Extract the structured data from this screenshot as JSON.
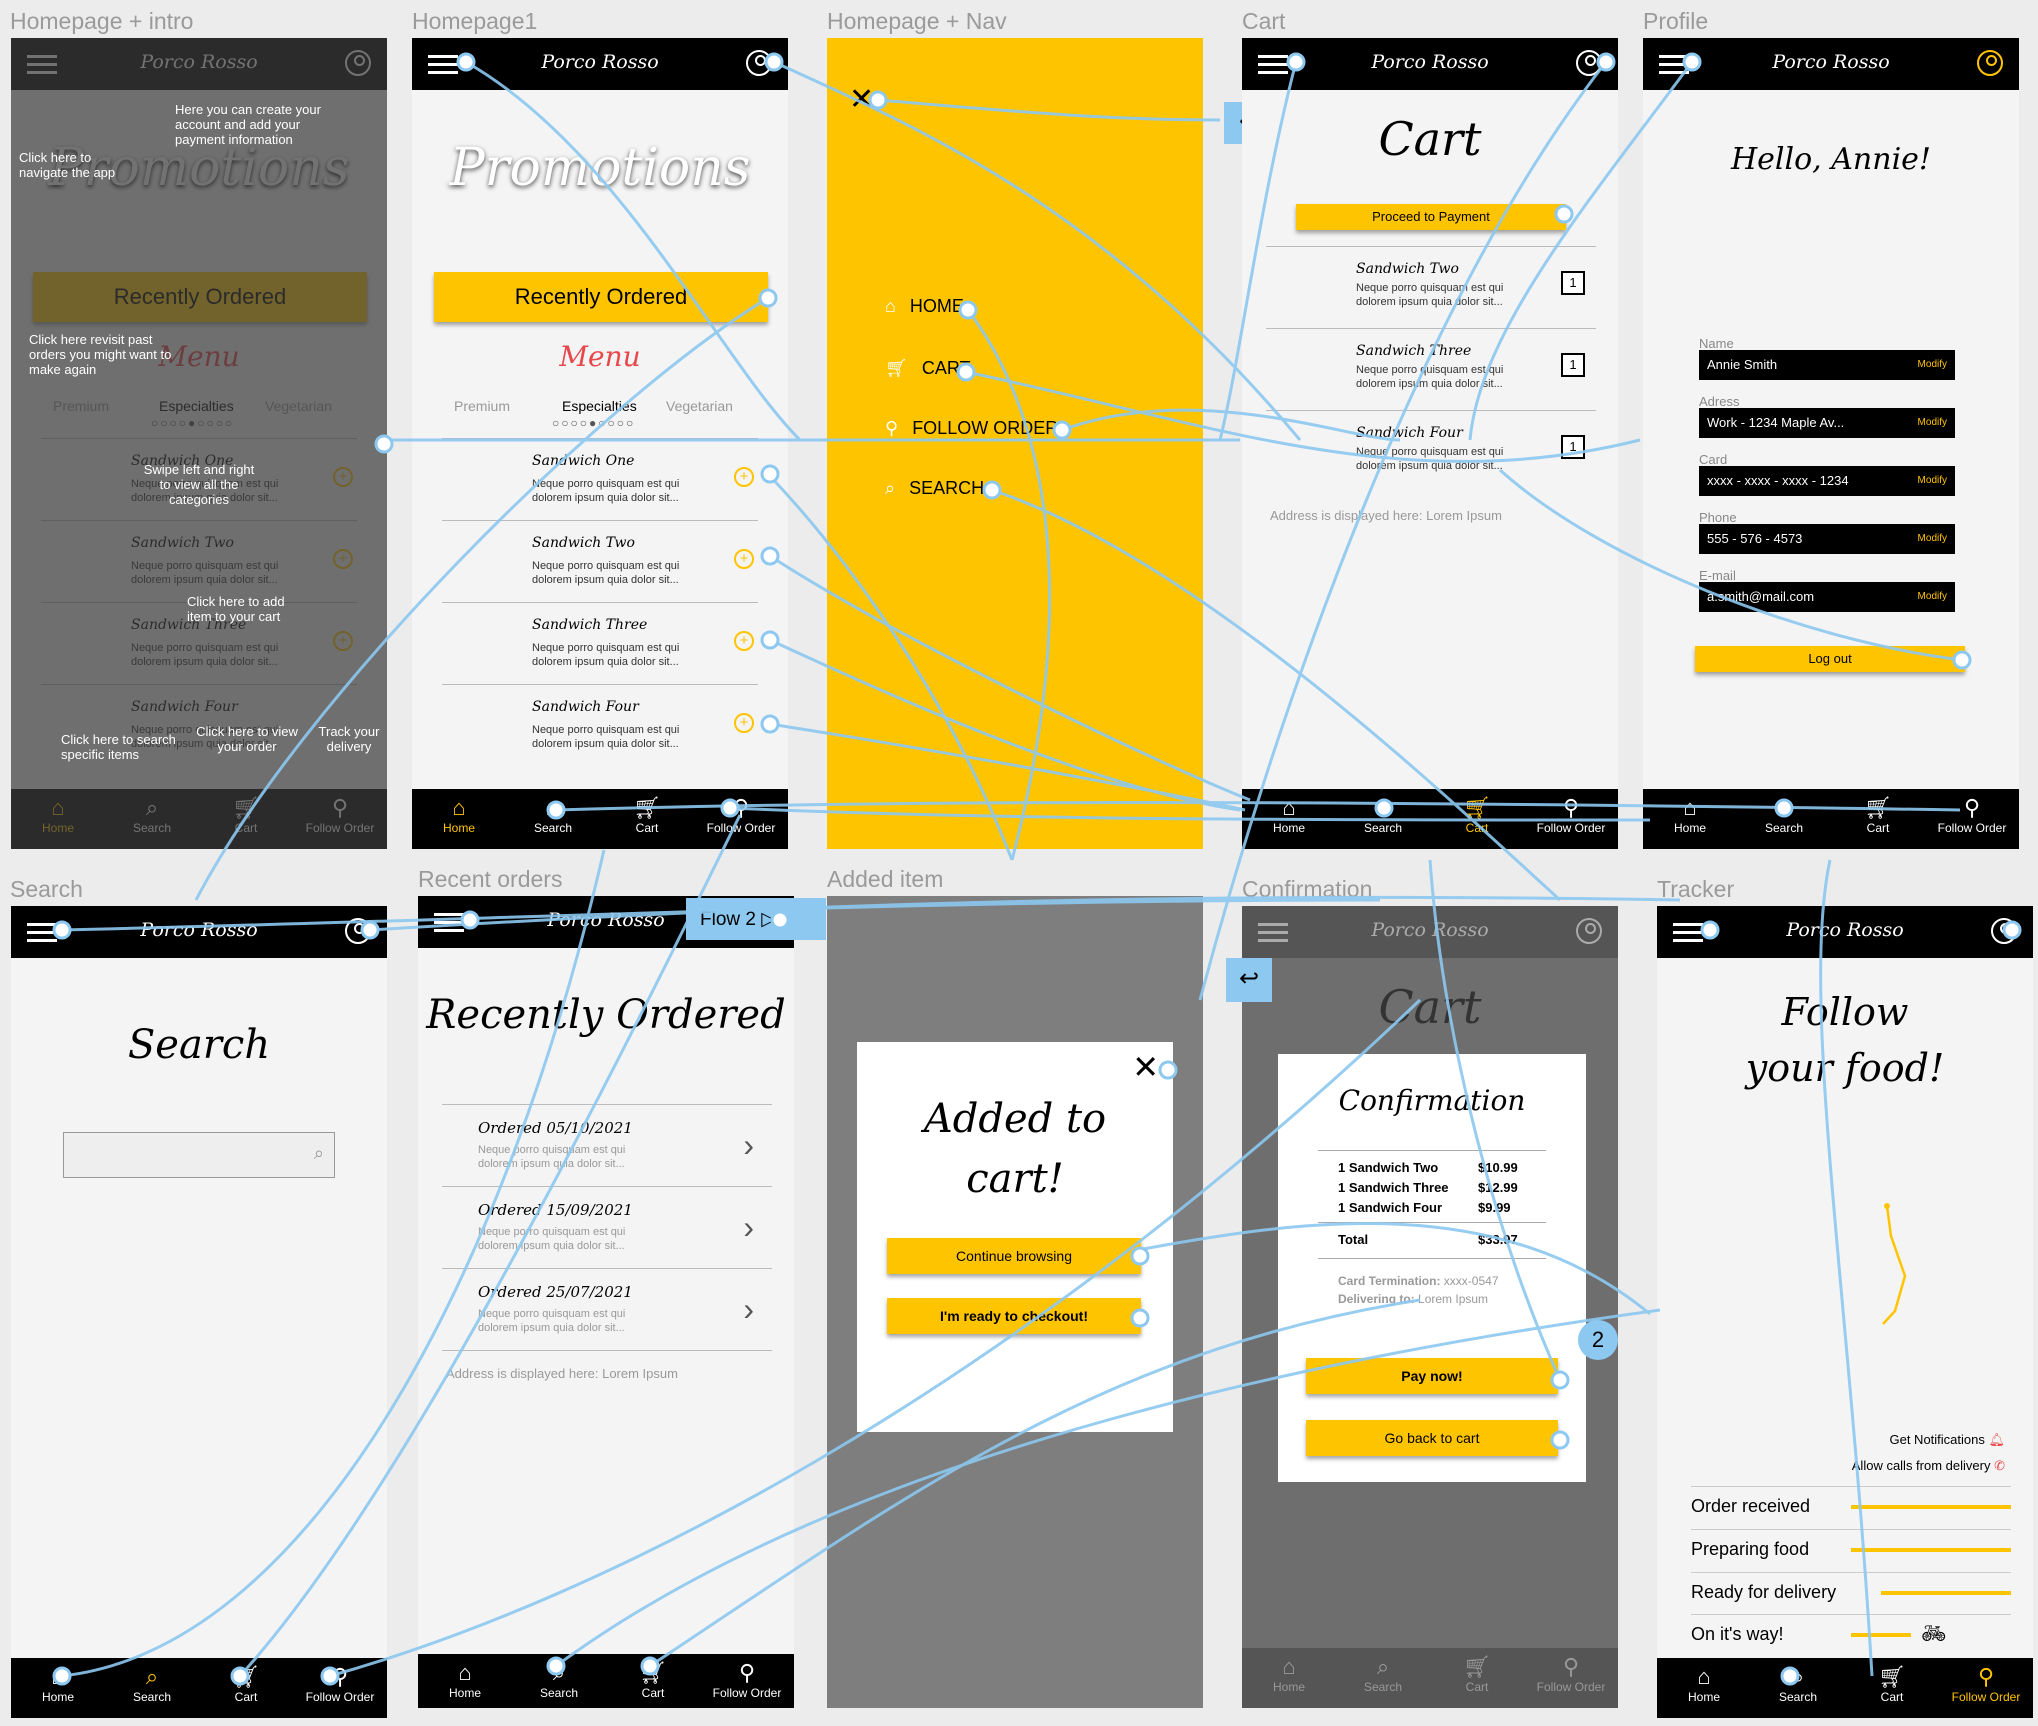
{
  "brand": "Porco Rosso",
  "frames": {
    "intro": "Homepage + intro",
    "home1": "Homepage1",
    "nav": "Homepage + Nav",
    "cart": "Cart",
    "profile": "Profile",
    "search": "Search",
    "recent": "Recent orders",
    "added": "Added item",
    "confirm": "Confirmation",
    "tracker": "Tracker"
  },
  "bottom_nav": [
    "Home",
    "Search",
    "Cart",
    "Follow Order"
  ],
  "home": {
    "promotions": "Promotions",
    "recently_ordered": "Recently Ordered",
    "menu_title": "Menu",
    "tabs": [
      "Premium",
      "Especialties",
      "Vegetarian"
    ],
    "items": [
      {
        "name": "Sandwich One",
        "desc": "Neque porro quisquam est qui dolorem ipsum quia dolor sit..."
      },
      {
        "name": "Sandwich Two",
        "desc": "Neque porro quisquam est qui dolorem ipsum quia dolor sit..."
      },
      {
        "name": "Sandwich Three",
        "desc": "Neque porro quisquam est qui dolorem ipsum quia dolor sit..."
      },
      {
        "name": "Sandwich Four",
        "desc": "Neque porro quisquam est qui dolorem ipsum quia dolor sit..."
      }
    ]
  },
  "intro_notes": {
    "nav": "Click here to navigate the app",
    "account": "Here you can create your account and add your payment information",
    "revisit": "Click here revisit past orders you might want to make again",
    "swipe": "Swipe left and right to view all the categories",
    "add": "Click here to add item to your cart",
    "search": "Click here to search specific items",
    "view": "Click here to view your order",
    "track": "Track your delivery"
  },
  "nav_menu": [
    "HOME",
    "CART",
    "FOLLOW ORDER",
    "SEARCH"
  ],
  "cart": {
    "title": "Cart",
    "proceed": "Proceed to Payment",
    "items": [
      {
        "name": "Sandwich Two",
        "desc": "Neque porro quisquam est qui dolorem ipsum quia dolor sit...",
        "qty": "1"
      },
      {
        "name": "Sandwich Three",
        "desc": "Neque porro quisquam est qui dolorem ipsum quia dolor sit...",
        "qty": "1"
      },
      {
        "name": "Sandwich Four",
        "desc": "Neque porro quisquam est qui dolorem ipsum quia dolor sit...",
        "qty": "1"
      }
    ],
    "address": "Address is displayed here: Lorem Ipsum"
  },
  "profile": {
    "hello": "Hello, Annie!",
    "modify": "Modify",
    "fields": [
      {
        "label": "Name",
        "value": "Annie Smith"
      },
      {
        "label": "Adress",
        "value": "Work - 1234 Maple Av..."
      },
      {
        "label": "Card",
        "value": "xxxx - xxxx - xxxx - 1234"
      },
      {
        "label": "Phone",
        "value": "555 - 576 - 4573"
      },
      {
        "label": "E-mail",
        "value": "a.smith@mail.com"
      }
    ],
    "logout": "Log out"
  },
  "search": {
    "title": "Search"
  },
  "recent": {
    "title": "Recently Ordered",
    "orders": [
      {
        "date": "Ordered 05/10/2021",
        "desc": "Neque porro quisquam est qui dolorem ipsum quia dolor sit..."
      },
      {
        "date": "Ordered 15/09/2021",
        "desc": "Neque porro quisquam est qui dolorem ipsum quia dolor sit..."
      },
      {
        "date": "Ordered 25/07/2021",
        "desc": "Neque porro quisquam est qui dolorem ipsum quia dolor sit..."
      }
    ],
    "address": "Address is displayed here: Lorem Ipsum",
    "flow": "Flow 2"
  },
  "added": {
    "title_l1": "Added to",
    "title_l2": "cart!",
    "continue": "Continue browsing",
    "checkout": "I'm ready to checkout!"
  },
  "confirm": {
    "bg_title": "Cart",
    "title": "Confirmation",
    "lines": [
      {
        "item": "1 Sandwich Two",
        "price": "$10.99"
      },
      {
        "item": "1 Sandwich Three",
        "price": "$12.99"
      },
      {
        "item": "1 Sandwich Four",
        "price": "$9.99"
      }
    ],
    "total_label": "Total",
    "total": "$33.97",
    "card_label": "Card Termination:",
    "card": "xxxx-0547",
    "deliver_label": "Delivering to:",
    "deliver": "Lorem Ipsum",
    "pay": "Pay now!",
    "back": "Go back to cart",
    "badge": "2"
  },
  "tracker": {
    "title_l1": "Follow",
    "title_l2": "your food!",
    "notif": "Get Notifications",
    "calls": "Allow calls from delivery",
    "steps": [
      "Order received",
      "Preparing food",
      "Ready for delivery",
      "On it's way!"
    ]
  },
  "colors": {
    "accent": "#ffc400",
    "wire": "#8cc8f0",
    "menu_red": "#e8474b"
  }
}
